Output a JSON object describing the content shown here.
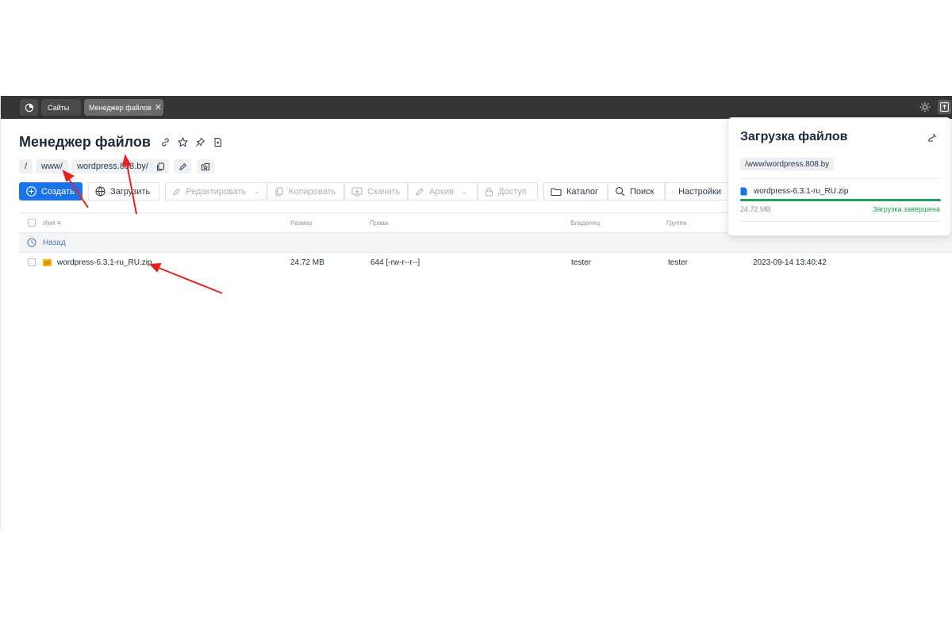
{
  "topbar": {
    "tabs": [
      {
        "label": "Сайты"
      },
      {
        "label": "Менеджер файлов"
      }
    ]
  },
  "page": {
    "title": "Менеджер файлов"
  },
  "breadcrumb": {
    "items": [
      "/",
      "www/",
      "wordpress.808.by/"
    ]
  },
  "toolbar": {
    "create": "Создать",
    "upload": "Загрузить",
    "edit": "Редактировать",
    "copy": "Копировать",
    "download": "Скачать",
    "archive": "Архив",
    "access": "Доступ",
    "catalog": "Каталог",
    "search": "Поиск",
    "settings": "Настройки"
  },
  "table": {
    "headers": {
      "name": "Имя",
      "size": "Размер",
      "rights": "Права",
      "owner": "Владелец",
      "group": "Группа"
    },
    "back_label": "Назад",
    "rows": [
      {
        "name": "wordpress-6.3.1-ru_RU.zip",
        "size": "24.72 MB",
        "rights": "644 [-rw-r--r--]",
        "owner": "tester",
        "group": "tester",
        "modified": "2023-09-14 13:40:42"
      }
    ]
  },
  "upload_panel": {
    "title": "Загрузка файлов",
    "path": "/www/wordpress.808.by",
    "file_name": "wordpress-6.3.1-ru_RU.zip",
    "file_size": "24.72 MB",
    "status": "Загрузка завершена",
    "progress": 1.0
  },
  "colors": {
    "accent": "#1a73e8",
    "success": "#1fa15a",
    "topbar": "#353535",
    "annotation_arrow": "#e52222"
  },
  "icons": {
    "logo": "dashboard-gauge-icon",
    "theme": "sun-icon",
    "uploads": "upload-queue-icon",
    "file_type": "zip-file-icon"
  }
}
